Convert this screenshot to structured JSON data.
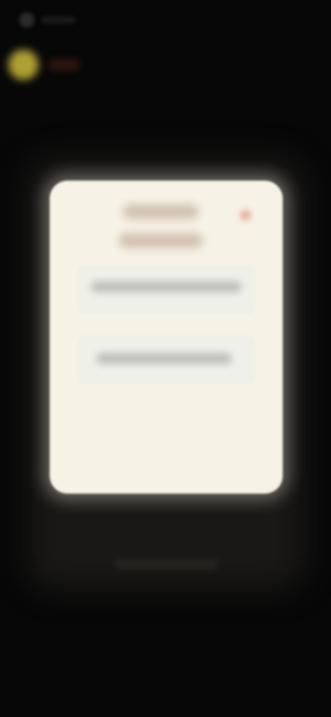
{
  "screen": {
    "status": "blurred"
  },
  "modal": {
    "title": "",
    "options": [
      {
        "label": ""
      },
      {
        "label": ""
      }
    ]
  },
  "colors": {
    "background": "#070707",
    "modal": "#f6f2e6",
    "avatar": "#cdbb3b",
    "close": "#e8b0a0"
  },
  "icons": {
    "back": "back-icon",
    "close": "close-icon"
  }
}
